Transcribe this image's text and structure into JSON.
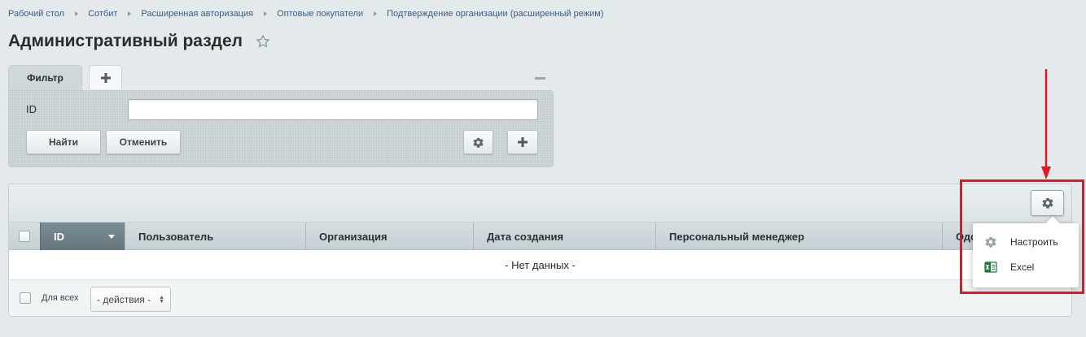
{
  "breadcrumb": [
    "Рабочий стол",
    "Сотбит",
    "Расширенная авторизация",
    "Оптовые покупатели",
    "Подтверждение организации (расширенный режим)"
  ],
  "page_title": "Административный раздел",
  "filter": {
    "tab_label": "Фильтр",
    "field_label": "ID",
    "field_value": "",
    "find_label": "Найти",
    "cancel_label": "Отменить"
  },
  "grid": {
    "columns": [
      "ID",
      "Пользователь",
      "Организация",
      "Дата создания",
      "Персональный менеджер",
      "Одо"
    ],
    "empty_text": "- Нет данных -",
    "footer": {
      "for_all_label": "Для всех",
      "actions_value": "- действия -"
    }
  },
  "settings_menu": {
    "items": [
      {
        "label": "Настроить",
        "icon": "gear-icon"
      },
      {
        "label": "Excel",
        "icon": "excel-icon"
      }
    ]
  },
  "colors": {
    "background": "#e4eaec",
    "breadcrumb": "#3d5b7e",
    "active_header": "#6f8088",
    "annotation": "#e5161d"
  }
}
